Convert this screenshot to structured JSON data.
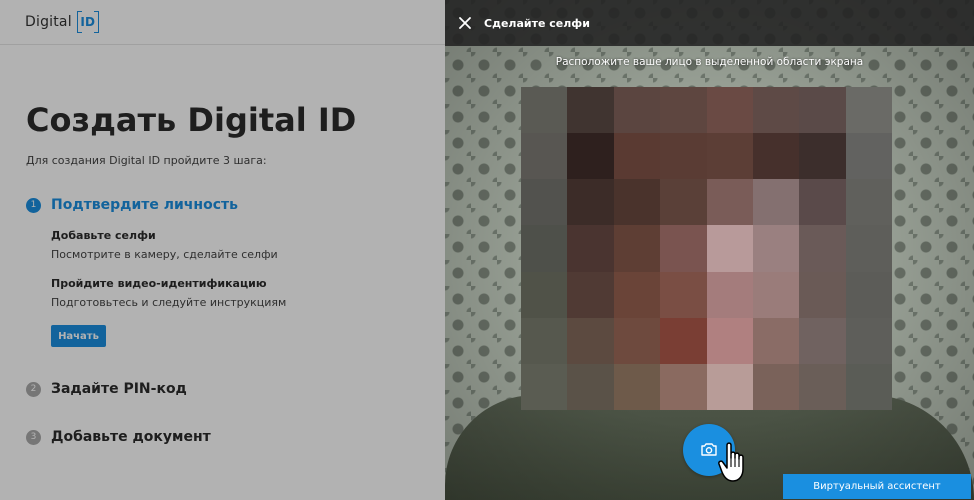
{
  "left_panel": {
    "logo": {
      "text": "Digital",
      "mark": "ID"
    },
    "title": "Создать Digital ID",
    "subtitle": "Для создания Digital ID пройдите 3 шага:",
    "steps": [
      {
        "number": "1",
        "title": "Подтвердите личность",
        "state": "active",
        "substeps": [
          {
            "title": "Добавьте селфи",
            "description": "Посмотрите в камеру, сделайте селфи"
          },
          {
            "title": "Пройдите видео-идентификацию",
            "description": "Подготовьтесь и следуйте инструкциям"
          }
        ],
        "button_label": "Начать"
      },
      {
        "number": "2",
        "title": "Задайте PIN-код",
        "state": "inactive"
      },
      {
        "number": "3",
        "title": "Добавьте документ",
        "state": "inactive"
      }
    ]
  },
  "camera_panel": {
    "title": "Сделайте селфи",
    "instruction": "Расположите ваше лицо в выделенной области экрана",
    "close_icon": "close-icon",
    "capture_icon": "camera-icon",
    "assistant_button": "Виртуальный ассистент"
  },
  "colors": {
    "accent": "#1a8fe0",
    "inactive_step": "#aaaaaa",
    "title_text": "#2b2b2b",
    "camera_topbar": "#232323"
  }
}
